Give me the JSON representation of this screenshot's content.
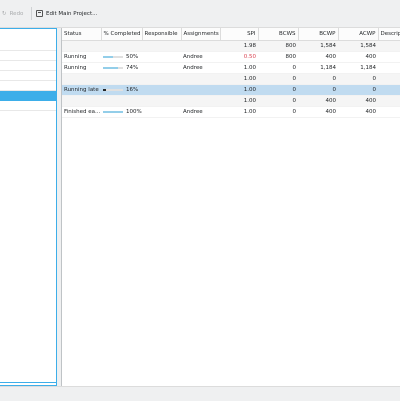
{
  "toolbar": {
    "redo_label": "Redo",
    "edit_main_label": "Edit Main Project..."
  },
  "columns": [
    "Status",
    "% Completed",
    "Responsible",
    "Assignments",
    "SPI",
    "BCWS",
    "BCWP",
    "ACWP",
    "Description"
  ],
  "rows": [
    {
      "status": "",
      "progress": null,
      "progress_label": "",
      "responsible": "",
      "assignments": "",
      "spi": "1.98",
      "bcws": "800",
      "bcwp": "1,584",
      "acwp": "1,584",
      "description": ""
    },
    {
      "status": "Running",
      "progress": 0.5,
      "progress_label": "50%",
      "responsible": "",
      "assignments": "Andree",
      "spi": "0.50",
      "bcws": "800",
      "bcwp": "400",
      "acwp": "400",
      "description": ""
    },
    {
      "status": "Running",
      "progress": 0.74,
      "progress_label": "74%",
      "responsible": "",
      "assignments": "Andree",
      "spi": "1.00",
      "bcws": "0",
      "bcwp": "1,184",
      "acwp": "1,184",
      "description": ""
    },
    {
      "status": "",
      "progress": null,
      "progress_label": "",
      "responsible": "",
      "assignments": "",
      "spi": "1.00",
      "bcws": "0",
      "bcwp": "0",
      "acwp": "0",
      "description": ""
    },
    {
      "status": "Running late",
      "progress": 0.16,
      "progress_label": "16%",
      "responsible": "",
      "assignments": "",
      "spi": "1.00",
      "bcws": "0",
      "bcwp": "0",
      "acwp": "0",
      "description": ""
    },
    {
      "status": "",
      "progress": null,
      "progress_label": "",
      "responsible": "",
      "assignments": "",
      "spi": "1.00",
      "bcws": "0",
      "bcwp": "400",
      "acwp": "400",
      "description": ""
    },
    {
      "status": "Finished ea...",
      "progress": 1.0,
      "progress_label": "100%",
      "responsible": "",
      "assignments": "Andree",
      "spi": "1.00",
      "bcws": "0",
      "bcwp": "400",
      "acwp": "400",
      "description": ""
    }
  ],
  "colors": {
    "accent": "#3daee9",
    "selection": "#c0dbf0",
    "negative": "#da4453"
  }
}
